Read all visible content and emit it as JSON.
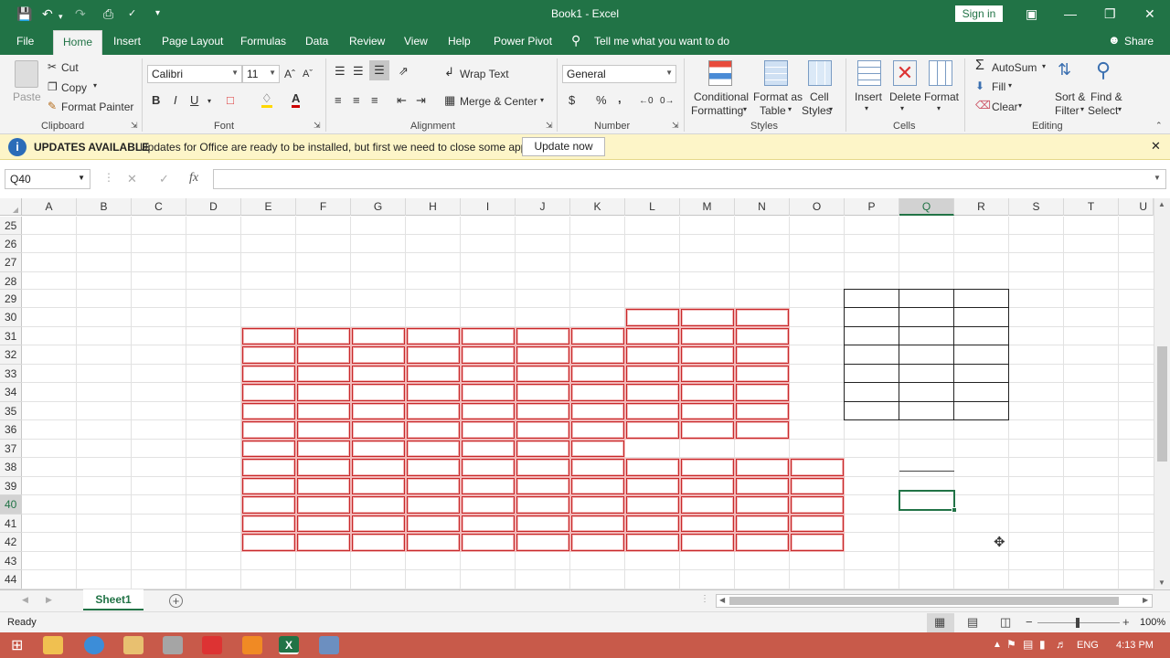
{
  "title": {
    "doc": "Book1",
    "sep": " - ",
    "app": "Excel",
    "signin": "Sign in"
  },
  "tabs": [
    "File",
    "Home",
    "Insert",
    "Page Layout",
    "Formulas",
    "Data",
    "Review",
    "View",
    "Help",
    "Power Pivot"
  ],
  "tell_me": "Tell me what you want to do",
  "share": "Share",
  "clipboard": {
    "paste": "Paste",
    "cut": "Cut",
    "copy": "Copy",
    "format_painter": "Format Painter",
    "label": "Clipboard"
  },
  "font": {
    "name": "Calibri",
    "size": "11",
    "bold": "B",
    "italic": "I",
    "underline": "U",
    "label": "Font"
  },
  "alignment": {
    "wrap": "Wrap Text",
    "merge": "Merge & Center",
    "label": "Alignment"
  },
  "number": {
    "format": "General",
    "currency": "$",
    "percent": "%",
    "comma": ",",
    "label": "Number"
  },
  "styles": {
    "cond1": "Conditional",
    "cond2": "Formatting",
    "fmt1": "Format as",
    "fmt2": "Table",
    "cell1": "Cell",
    "cell2": "Styles",
    "label": "Styles"
  },
  "cells": {
    "insert": "Insert",
    "delete": "Delete",
    "format": "Format",
    "label": "Cells"
  },
  "editing": {
    "autosum": "AutoSum",
    "fill": "Fill",
    "clear": "Clear",
    "sort1": "Sort &",
    "sort2": "Filter",
    "find1": "Find &",
    "find2": "Select",
    "label": "Editing"
  },
  "update": {
    "title": "UPDATES AVAILABLE",
    "message": "Updates for Office are ready to be installed, but first we need to close some apps.",
    "button": "Update now"
  },
  "formula_bar": {
    "name_box": "Q40",
    "fx": "fx",
    "value": ""
  },
  "columns": [
    "A",
    "B",
    "C",
    "D",
    "E",
    "F",
    "G",
    "H",
    "I",
    "J",
    "K",
    "L",
    "M",
    "N",
    "O",
    "P",
    "Q",
    "R",
    "S",
    "T",
    "U"
  ],
  "selected_column": "Q",
  "rows": [
    "25",
    "26",
    "27",
    "28",
    "29",
    "30",
    "31",
    "32",
    "33",
    "34",
    "35",
    "36",
    "37",
    "38",
    "39",
    "40",
    "41",
    "42",
    "43",
    "44"
  ],
  "selected_row": "40",
  "sheet": {
    "tab": "Sheet1"
  },
  "status": {
    "ready": "Ready",
    "zoom": "100%"
  },
  "taskbar": {
    "lang": "ENG",
    "time": "4:13 PM"
  },
  "colors": {
    "excel_green": "#217346",
    "red_border": "#c8282a",
    "update_bar": "#fdf5c8",
    "taskbar": "#c85a4a"
  }
}
